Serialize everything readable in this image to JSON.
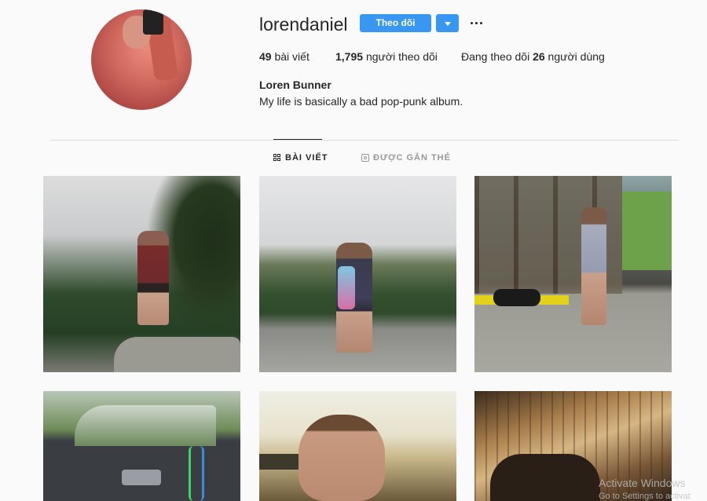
{
  "profile": {
    "username": "lorendaniel",
    "follow_label": "Theo dõi",
    "full_name": "Loren Bunner",
    "bio": "My life is basically a bad pop-punk album."
  },
  "stats": {
    "posts_count": "49",
    "posts_label": "bài viết",
    "followers_count": "1,795",
    "followers_label": "người theo dõi",
    "following_prefix": "Đang theo dõi",
    "following_count": "26",
    "following_label": "người dùng"
  },
  "tabs": {
    "posts": "BÀI VIẾT",
    "tagged": "ĐƯỢC GẮN THẺ"
  },
  "watermark": {
    "line1": "Activate Windows",
    "line2": "Go to Settings to activat"
  },
  "colors": {
    "accent": "#3897f0",
    "text": "#262626",
    "background": "#fafafa",
    "divider": "#dbdbdb"
  },
  "icons": [
    "avatar",
    "chevron-down-icon",
    "more-options-icon",
    "grid-icon",
    "tag-icon"
  ]
}
